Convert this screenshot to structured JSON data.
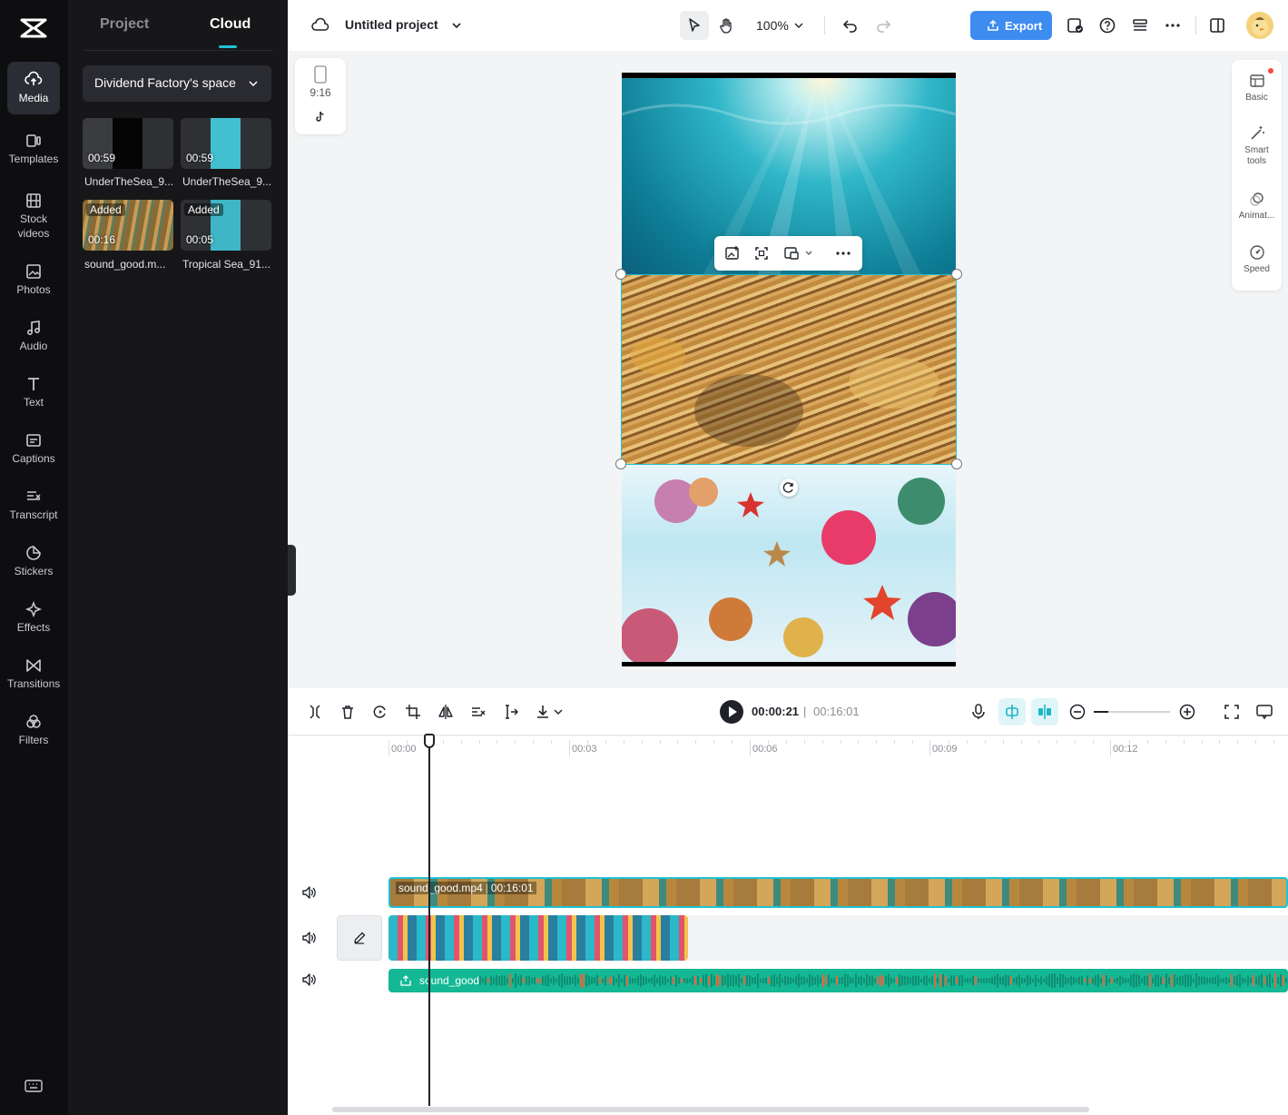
{
  "left_rail": {
    "items": [
      {
        "label": "Media",
        "icon": "cloud-upload-icon",
        "active": true
      },
      {
        "label": "Templates",
        "icon": "templates-icon"
      },
      {
        "label": "Stock videos",
        "icon": "film-icon"
      },
      {
        "label": "Photos",
        "icon": "image-icon"
      },
      {
        "label": "Audio",
        "icon": "music-note-icon"
      },
      {
        "label": "Text",
        "icon": "text-t-icon"
      },
      {
        "label": "Captions",
        "icon": "captions-icon"
      },
      {
        "label": "Transcript",
        "icon": "transcript-icon"
      },
      {
        "label": "Stickers",
        "icon": "sticker-icon"
      },
      {
        "label": "Effects",
        "icon": "sparkle-icon"
      },
      {
        "label": "Transitions",
        "icon": "bowtie-icon"
      },
      {
        "label": "Filters",
        "icon": "filters-icon"
      }
    ]
  },
  "panel": {
    "tabs": [
      "Project",
      "Cloud"
    ],
    "active_tab": "Cloud",
    "space_name": "Dividend Factory's space",
    "media": [
      {
        "name": "UnderTheSea_9...",
        "duration": "00:59",
        "badge": ""
      },
      {
        "name": "UnderTheSea_9...",
        "duration": "00:59",
        "badge": ""
      },
      {
        "name": "sound_good.m...",
        "duration": "00:16",
        "badge": "Added"
      },
      {
        "name": "Tropical Sea_91...",
        "duration": "00:05",
        "badge": "Added"
      }
    ]
  },
  "topbar": {
    "project_title": "Untitled project",
    "zoom": "100%",
    "export_label": "Export"
  },
  "ratio": {
    "label": "9:16"
  },
  "props_panel": {
    "items": [
      "Basic",
      "Smart tools",
      "Animat...",
      "Speed"
    ]
  },
  "timeline": {
    "current_time": "00:00:21",
    "separator": "|",
    "total_time": "00:16:01",
    "ruler": [
      "00:00",
      "00:03",
      "00:06",
      "00:09",
      "00:12"
    ],
    "main_clip": {
      "name": "sound_good.mp4",
      "duration": "00:16:01"
    },
    "audio_clip": {
      "name": "sound_good"
    }
  },
  "colors": {
    "accent": "#1fc2d4",
    "export": "#3e8cf0",
    "audio": "#14b894",
    "rail_bg": "#0e0e10",
    "panel_bg": "#17171a"
  }
}
